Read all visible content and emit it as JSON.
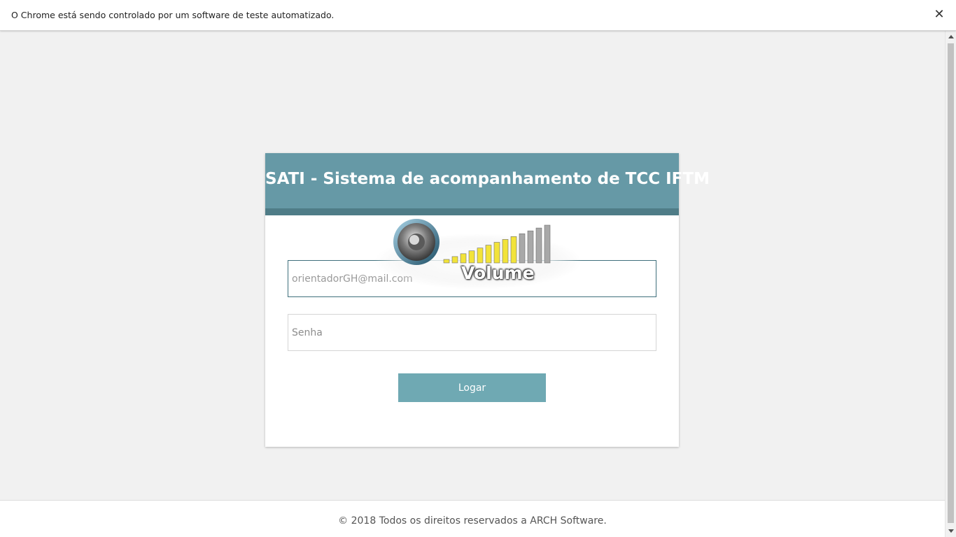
{
  "automation_bar": {
    "message": "O Chrome está sendo controlado por um software de teste automatizado.",
    "close_glyph": "✕"
  },
  "login": {
    "title": "SATI - Sistema de acompanhamento de TCC IFTM",
    "email_value": "orientadorGH@mail.com",
    "password_placeholder": "Senha",
    "button_label": "Logar"
  },
  "volume_overlay": {
    "label": "Volume",
    "level_bars_lit": 9,
    "level_bars_total": 13
  },
  "footer": {
    "text": "© 2018 Todos os direitos reservados a ARCH Software."
  },
  "colors": {
    "header": "#6699a6",
    "header_strip": "#4f7c87",
    "button": "#6fa9b3",
    "page_bg": "#f1f1f1",
    "volume_lit": "#f2e33a",
    "volume_unlit": "#a8a8a8"
  }
}
